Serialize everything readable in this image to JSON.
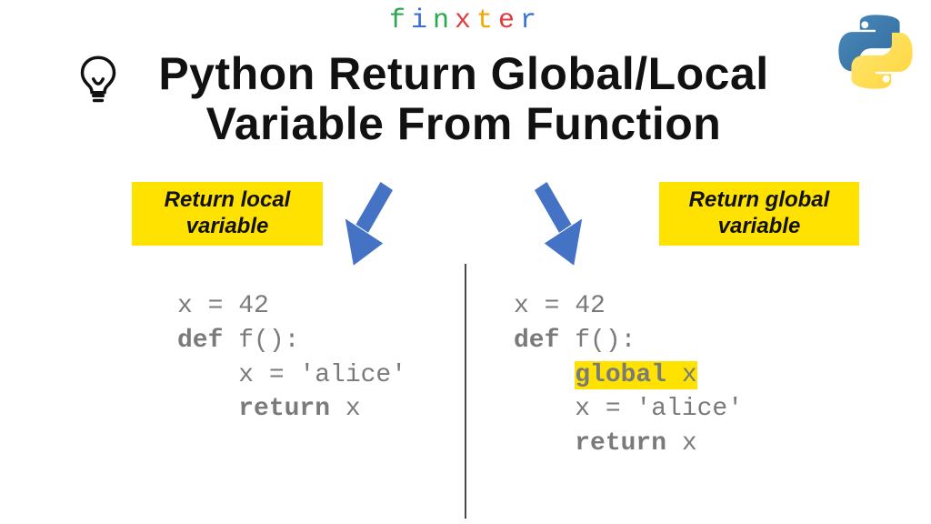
{
  "brand": {
    "letters": [
      "f",
      "i",
      "n",
      "x",
      "t",
      "e",
      "r"
    ],
    "colors": [
      "#2aa84f",
      "#3b6fd8",
      "#2aa84f",
      "#e23b3b",
      "#f0a500",
      "#e23b3b",
      "#3b6fd8"
    ]
  },
  "title": {
    "line1": "Python Return Global/Local",
    "line2": "Variable From Function"
  },
  "labels": {
    "left_line1": "Return local",
    "left_line2": "variable",
    "right_line1": "Return global",
    "right_line2": "variable"
  },
  "code_left": {
    "l1": "x = 42",
    "l2a": "def",
    "l2b": " f():",
    "l3": "    x = 'alice'",
    "l4a": "    ",
    "l4b": "return",
    "l4c": " x"
  },
  "code_right": {
    "l1": "x = 42",
    "l2a": "def",
    "l2b": " f():",
    "l3a": "    ",
    "l3b": "global",
    "l3c": " x",
    "l4": "    x = 'alice'",
    "l5a": "    ",
    "l5b": "return",
    "l5c": " x"
  },
  "colors": {
    "arrow": "#4472c4",
    "highlight": "#ffe200",
    "code": "#7a7a7a"
  }
}
